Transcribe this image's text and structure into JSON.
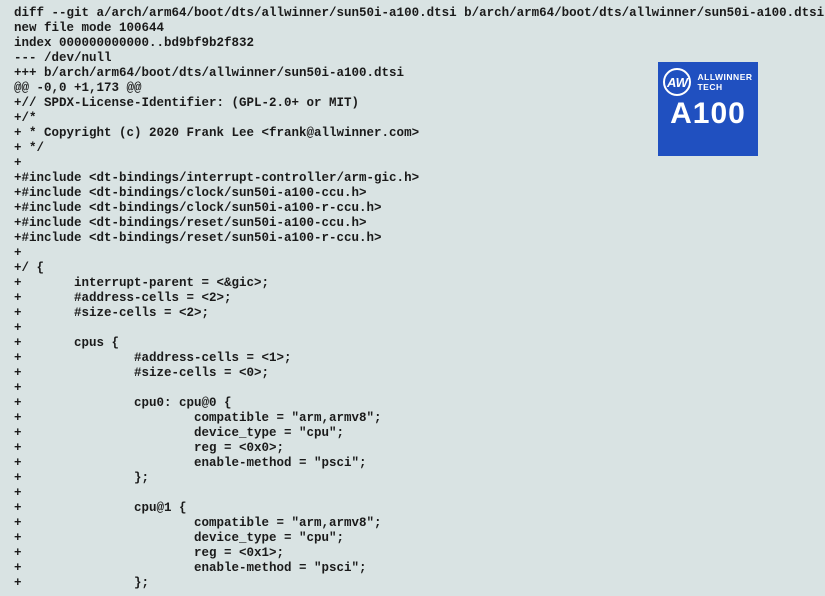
{
  "logo": {
    "brand_aw": "AW",
    "brand_line1": "ALLWINNER",
    "brand_line2": "TECH",
    "chip": "A100"
  },
  "diff": {
    "lines": [
      "diff --git a/arch/arm64/boot/dts/allwinner/sun50i-a100.dtsi b/arch/arm64/boot/dts/allwinner/sun50i-a100.dtsi",
      "new file mode 100644",
      "index 000000000000..bd9bf9b2f832",
      "--- /dev/null",
      "+++ b/arch/arm64/boot/dts/allwinner/sun50i-a100.dtsi",
      "@@ -0,0 +1,173 @@",
      "+// SPDX-License-Identifier: (GPL-2.0+ or MIT)",
      "+/*",
      "+ * Copyright (c) 2020 Frank Lee <frank@allwinner.com>",
      "+ */",
      "+",
      "+#include <dt-bindings/interrupt-controller/arm-gic.h>",
      "+#include <dt-bindings/clock/sun50i-a100-ccu.h>",
      "+#include <dt-bindings/clock/sun50i-a100-r-ccu.h>",
      "+#include <dt-bindings/reset/sun50i-a100-ccu.h>",
      "+#include <dt-bindings/reset/sun50i-a100-r-ccu.h>",
      "+",
      "+/ {",
      "+       interrupt-parent = <&gic>;",
      "+       #address-cells = <2>;",
      "+       #size-cells = <2>;",
      "+",
      "+       cpus {",
      "+               #address-cells = <1>;",
      "+               #size-cells = <0>;",
      "+",
      "+               cpu0: cpu@0 {",
      "+                       compatible = \"arm,armv8\";",
      "+                       device_type = \"cpu\";",
      "+                       reg = <0x0>;",
      "+                       enable-method = \"psci\";",
      "+               };",
      "+",
      "+               cpu@1 {",
      "+                       compatible = \"arm,armv8\";",
      "+                       device_type = \"cpu\";",
      "+                       reg = <0x1>;",
      "+                       enable-method = \"psci\";",
      "+               };"
    ]
  }
}
